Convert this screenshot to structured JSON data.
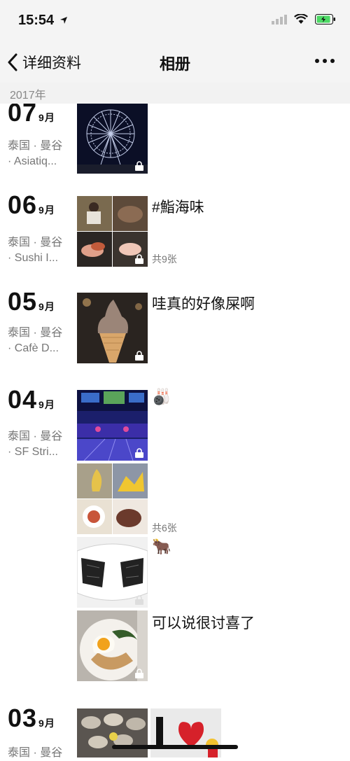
{
  "status_bar": {
    "time": "15:54"
  },
  "nav": {
    "back_label": "详细资料",
    "title": "相册"
  },
  "year_header": "2017年",
  "entries": {
    "e07": {
      "day": "07",
      "month": "9月",
      "loc1": "泰国 · 曼谷",
      "loc2": "· Asiatiq..."
    },
    "e06": {
      "day": "06",
      "month": "9月",
      "loc1": "泰国 · 曼谷",
      "loc2": "· Sushi I...",
      "caption": "#鮨海味",
      "count": "共9张"
    },
    "e05": {
      "day": "05",
      "month": "9月",
      "loc1": "泰国 · 曼谷",
      "loc2": "· Cafè D...",
      "caption": "哇真的好像屎啊"
    },
    "e04": {
      "day": "04",
      "month": "9月",
      "loc1": "泰国 · 曼谷",
      "loc2": "· SF Stri...",
      "post1_caption": "🎳",
      "post2_count": "共6张",
      "post3_caption": "🐂",
      "post4_caption": "可以说很讨喜了"
    },
    "e03": {
      "day": "03",
      "month": "9月",
      "loc1": "泰国 · 曼谷"
    }
  },
  "icons": [
    "location-arrow-icon",
    "signal-icon",
    "wifi-icon",
    "battery-icon",
    "back-chevron-icon",
    "more-icon",
    "lock-icon"
  ]
}
